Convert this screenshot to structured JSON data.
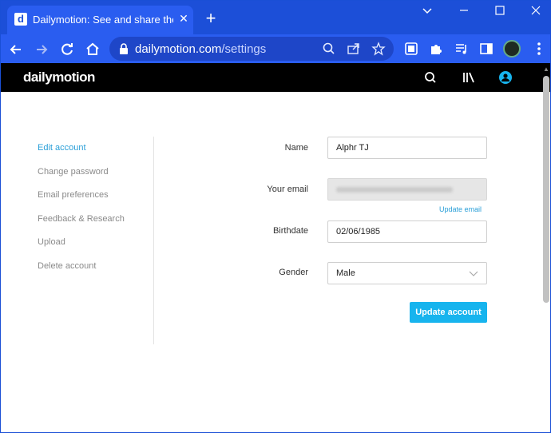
{
  "browser": {
    "tab": {
      "title": "Dailymotion: See and share the in",
      "favicon": "d"
    },
    "omnibox": {
      "host": "dailymotion.com",
      "path": "/settings"
    }
  },
  "site": {
    "logo": "dailymotion"
  },
  "sidebar": {
    "items": [
      {
        "label": "Edit account",
        "active": true
      },
      {
        "label": "Change password",
        "active": false
      },
      {
        "label": "Email preferences",
        "active": false
      },
      {
        "label": "Feedback & Research",
        "active": false
      },
      {
        "label": "Upload",
        "active": false
      },
      {
        "label": "Delete account",
        "active": false
      }
    ]
  },
  "form": {
    "name_label": "Name",
    "name_value": "Alphr TJ",
    "email_label": "Your email",
    "update_email_link": "Update email",
    "birthdate_label": "Birthdate",
    "birthdate_value": "02/06/1985",
    "gender_label": "Gender",
    "gender_value": "Male",
    "submit_label": "Update account"
  },
  "colors": {
    "browser_chrome": "#1c4fd8",
    "accent": "#17b4ee",
    "link": "#2a9fd8",
    "header_bg": "#000000"
  }
}
